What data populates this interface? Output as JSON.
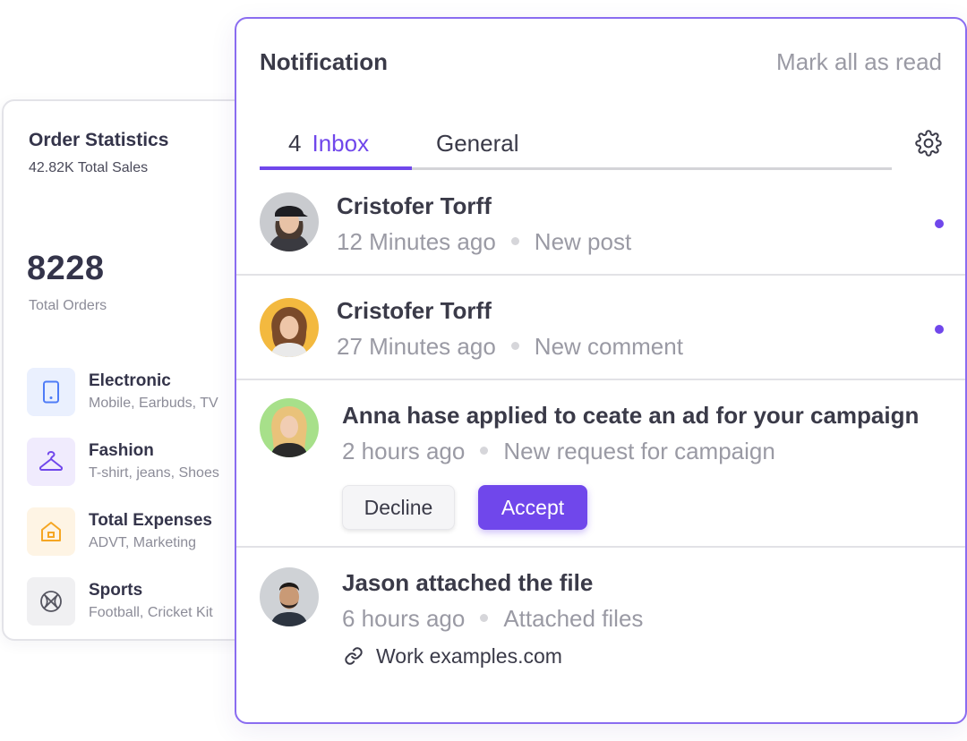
{
  "order_stats": {
    "title": "Order Statistics",
    "subtitle": "42.82K Total Sales",
    "total": "8228",
    "total_label": "Total Orders",
    "categories": [
      {
        "name": "Electronic",
        "desc": "Mobile, Earbuds, TV",
        "icon": "tablet-icon",
        "color": "#4f7cf7",
        "bg": "#eaf0fe"
      },
      {
        "name": "Fashion",
        "desc": "T-shirt, jeans, Shoes",
        "icon": "hanger-icon",
        "color": "#7047eb",
        "bg": "#f0ebfd"
      },
      {
        "name": "Total Expenses",
        "desc": "ADVT, Marketing",
        "icon": "home-icon",
        "color": "#f5a623",
        "bg": "#fef4e4"
      },
      {
        "name": "Sports",
        "desc": "Football, Cricket Kit",
        "icon": "basketball-icon",
        "color": "#555560",
        "bg": "#f0f0f2"
      }
    ]
  },
  "notification": {
    "title": "Notification",
    "mark_all": "Mark all as read",
    "tabs": {
      "inbox_count": "4",
      "inbox_label": "Inbox",
      "general_label": "General"
    },
    "items": [
      {
        "name": "Cristofer Torff",
        "time": "12 Minutes ago",
        "type": "New post",
        "unread": true
      },
      {
        "name": "Cristofer Torff",
        "time": "27 Minutes ago",
        "type": "New comment",
        "unread": true
      },
      {
        "name": "Anna hase applied to ceate an ad for your campaign",
        "time": "2 hours ago",
        "type": "New request for campaign",
        "decline": "Decline",
        "accept": "Accept"
      },
      {
        "name": "Jason attached the file",
        "time": "6 hours ago",
        "type": "Attached files",
        "link": "Work examples.com"
      }
    ],
    "colors": {
      "accent": "#7047eb",
      "border": "#8a6cf0"
    }
  }
}
